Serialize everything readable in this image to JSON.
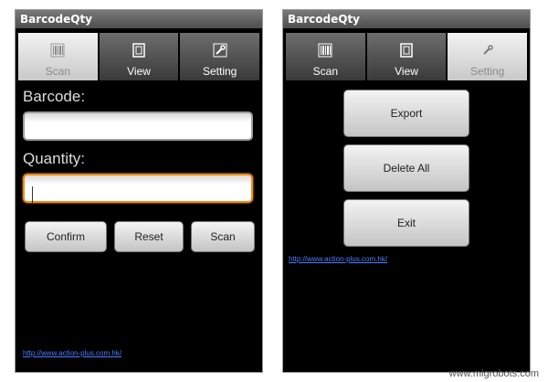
{
  "app": {
    "title": "BarcodeQty"
  },
  "tabs": [
    {
      "label": "Scan",
      "icon": "barcode-icon"
    },
    {
      "label": "View",
      "icon": "document-icon"
    },
    {
      "label": "Setting",
      "icon": "wrench-icon"
    }
  ],
  "scan_screen": {
    "active_tab": "Scan",
    "barcode_label": "Barcode:",
    "barcode_value": "",
    "quantity_label": "Quantity:",
    "quantity_value": "",
    "buttons": {
      "confirm": "Confirm",
      "reset": "Reset",
      "scan": "Scan"
    },
    "link": "http://www.action-plus.com.hk/"
  },
  "setting_screen": {
    "active_tab": "Setting",
    "buttons": {
      "export": "Export",
      "delete_all": "Delete All",
      "exit": "Exit"
    },
    "link": "http://www.action-plus.com.hk/"
  },
  "watermark": "www.mlgrobots.com",
  "colors": {
    "focus_border": "#f08a18",
    "link": "#4d7dff",
    "active_tab_text": "#8a8a8a"
  }
}
